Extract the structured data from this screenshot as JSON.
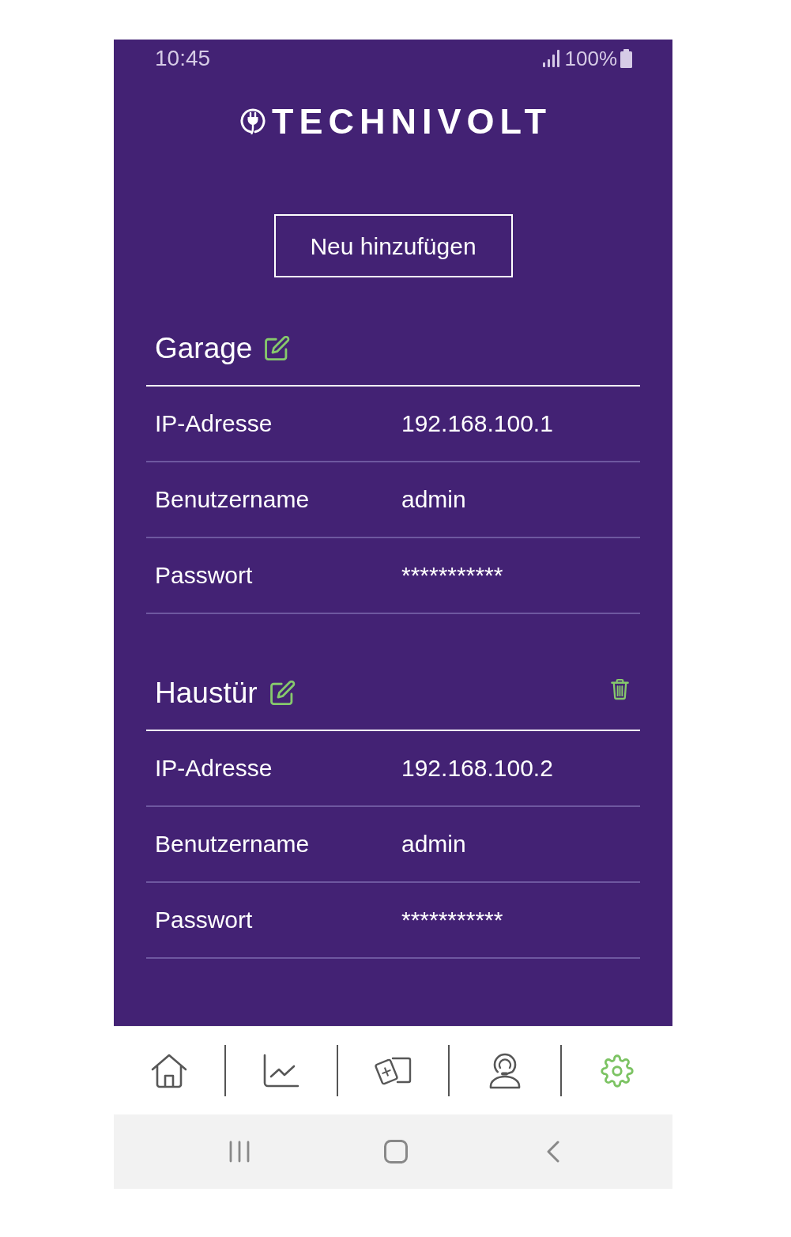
{
  "status_bar": {
    "time": "10:45",
    "battery": "100%"
  },
  "logo": {
    "text": "TECHNIVOLT"
  },
  "add_button": {
    "label": "Neu hinzufügen"
  },
  "devices": [
    {
      "name": "Garage",
      "deletable": false,
      "fields": [
        {
          "label": "IP-Adresse",
          "value": "192.168.100.1"
        },
        {
          "label": "Benutzername",
          "value": "admin"
        },
        {
          "label": "Passwort",
          "value": "***********"
        }
      ]
    },
    {
      "name": "Haustür",
      "deletable": true,
      "fields": [
        {
          "label": "IP-Adresse",
          "value": "192.168.100.2"
        },
        {
          "label": "Benutzername",
          "value": "admin"
        },
        {
          "label": "Passwort",
          "value": "***********"
        }
      ]
    }
  ],
  "bottom_nav": [
    {
      "selected": false
    },
    {
      "selected": false
    },
    {
      "selected": false
    },
    {
      "selected": false
    },
    {
      "selected": true
    }
  ]
}
